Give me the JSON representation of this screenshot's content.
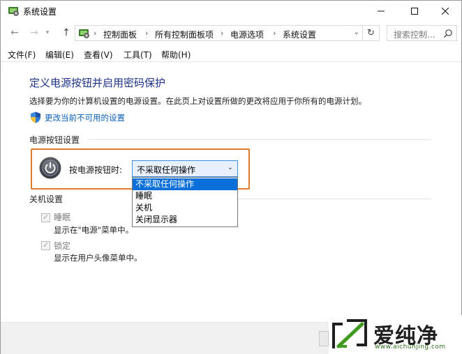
{
  "window": {
    "title": "系统设置",
    "buttons": {
      "minimize": "—",
      "maximize": "☐",
      "close": "✕"
    }
  },
  "addressbar": {
    "back": "←",
    "forward": "→",
    "up": "↑",
    "breadcrumbs": [
      "控制面板",
      "所有控制面板项",
      "电源选项",
      "系统设置"
    ],
    "separator": "›",
    "refresh": "↻",
    "search_placeholder": "搜索控制..."
  },
  "menu": [
    "文件(F)",
    "编辑(E)",
    "查看(V)",
    "工具(T)",
    "帮助(H)"
  ],
  "content": {
    "heading": "定义电源按钮并启用密码保护",
    "description": "选择要为你的计算机设置的电源设置。在此页上对设置所做的更改将应用于你所有的电源计划。",
    "change_link": "更改当前不可用的设置",
    "power_section": {
      "title": "电源按钮设置",
      "label": "按电源按钮时:",
      "selected": "不采取任何操作",
      "options": [
        "不采取任何操作",
        "睡眠",
        "关机",
        "关闭显示器"
      ]
    },
    "shutdown_section": {
      "title": "关机设置",
      "items": [
        {
          "label": "睡眠",
          "checked": true,
          "desc": "显示在\"电源\"菜单中。"
        },
        {
          "label": "锁定",
          "checked": true,
          "desc": "显示在用户头像菜单中。"
        }
      ]
    }
  },
  "watermark": {
    "title": "爱纯净",
    "url": "www.aichunjing.com"
  },
  "colors": {
    "heading": "#1e3287",
    "link": "#0b5fb8",
    "highlight": "#e07b2c",
    "selected_option": "#0a6fd8"
  }
}
